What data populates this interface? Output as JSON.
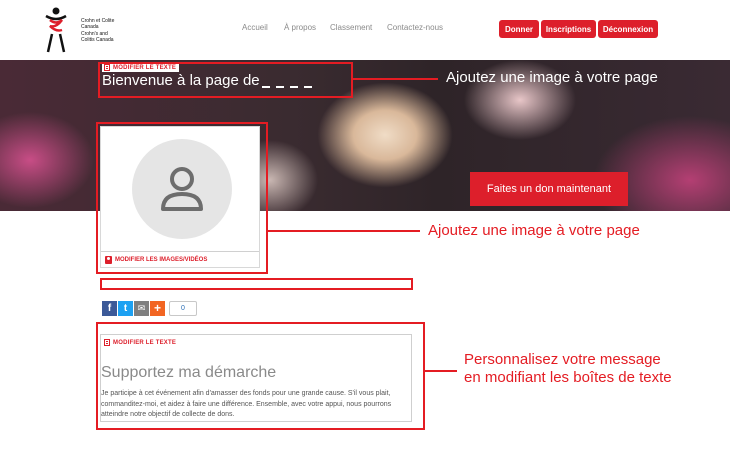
{
  "header": {
    "logo_text_fr": "Crohn et Colite Canada",
    "logo_text_en": "Crohn's and Colitis Canada",
    "nav": [
      "Accueil",
      "À propos",
      "Classement",
      "Contactez-nous"
    ],
    "buttons": [
      "Donner",
      "Inscriptions",
      "Déconnexion"
    ]
  },
  "banner": {
    "edit_label": "MODIFIER LE TEXTE",
    "welcome": "Bienvenue à la page de",
    "donate_button": "Faites un don maintenant"
  },
  "profile": {
    "edit_label": "MODIFIER LES IMAGES/VIDÉOS"
  },
  "share": {
    "facebook": "f",
    "twitter": "t",
    "email": "✉",
    "plus": "+",
    "count": "0"
  },
  "support": {
    "edit_label": "MODIFIER LE TEXTE",
    "title": "Supportez ma démarche",
    "body": "Je participe à cet événement afin d'amasser des fonds pour une grande cause. S'il vous plait, commanditez-moi, et aidez à faire une différence. Ensemble, avec votre appui, nous pourrons atteindre notre objectif de collecte de dons."
  },
  "callouts": {
    "banner_image": "Ajoutez une image à votre page",
    "profile_image": "Ajoutez une image à votre page",
    "message_line1": "Personnalisez votre message",
    "message_line2": "en modifiant les boîtes de texte"
  },
  "colors": {
    "brand_red": "#dd1f2b",
    "annotation_red": "#e41c23",
    "facebook": "#3b5998",
    "twitter": "#1da1f2",
    "email": "#7f7f7f",
    "plus": "#f26522"
  },
  "icons": [
    "person-icon",
    "edit-text-icon",
    "image-icon"
  ]
}
